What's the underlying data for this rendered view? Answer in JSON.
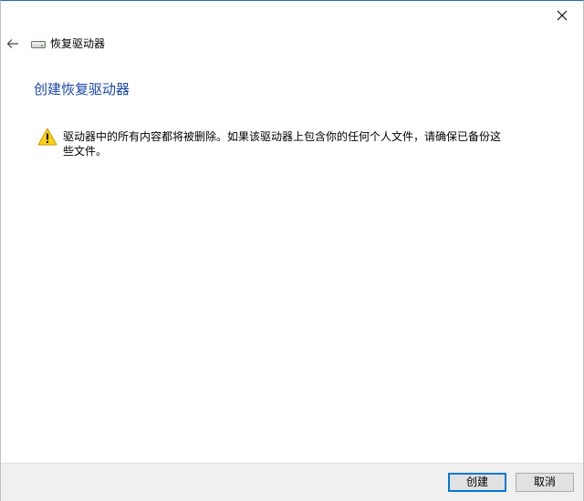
{
  "window": {
    "nav_title": "恢复驱动器",
    "page_title": "创建恢复驱动器"
  },
  "icons": {
    "back": "back-arrow-icon",
    "drive": "drive-icon",
    "warning": "warning-icon",
    "close": "close-icon"
  },
  "warning": {
    "message": "驱动器中的所有内容都将被删除。如果该驱动器上包含你的任何个人文件，请确保已备份这些文件。"
  },
  "footer": {
    "create_label": "创建",
    "cancel_label": "取消"
  },
  "colors": {
    "title_blue": "#1a47a6",
    "primary_border": "#0078d7",
    "warning_yellow": "#fcd116"
  }
}
